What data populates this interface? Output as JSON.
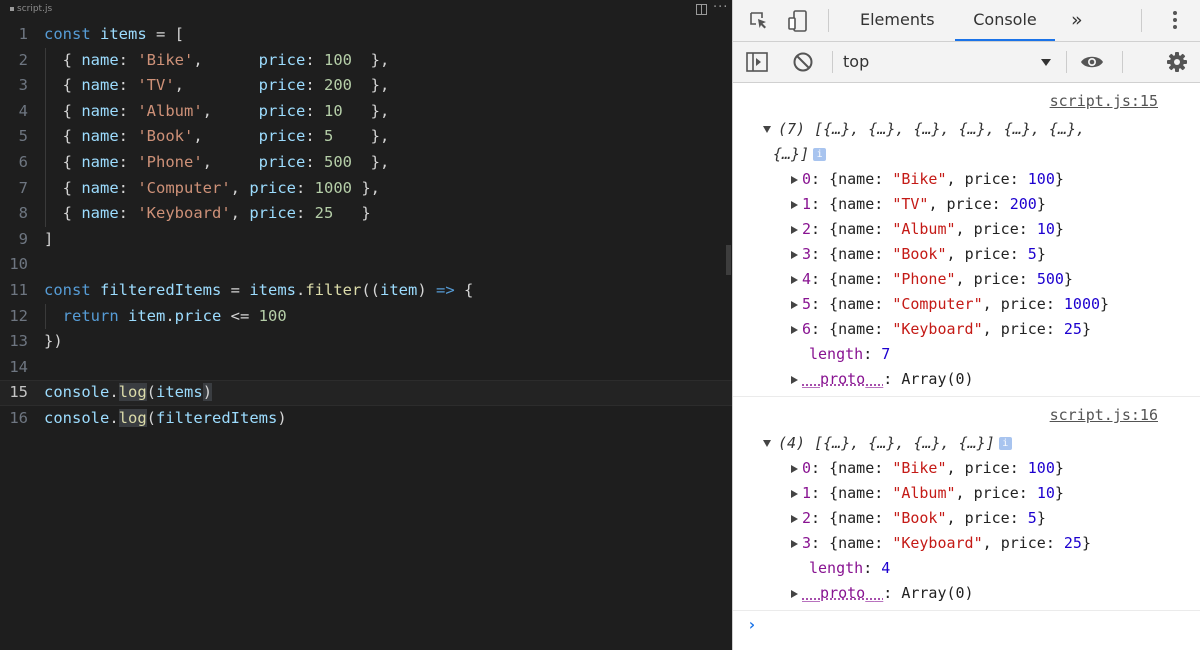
{
  "editor": {
    "tab_title": "script.js",
    "more_label": "···",
    "current_line": 15,
    "lines": [
      {
        "num": "1",
        "tokens": [
          {
            "t": "const ",
            "c": "kw"
          },
          {
            "t": "items",
            "c": "vr"
          },
          {
            "t": " = [",
            "c": "tx"
          }
        ]
      },
      {
        "num": "2",
        "tokens": [
          {
            "t": "  { ",
            "c": "tx"
          },
          {
            "t": "name",
            "c": "vr"
          },
          {
            "t": ": ",
            "c": "tx"
          },
          {
            "t": "'Bike'",
            "c": "st"
          },
          {
            "t": ",      ",
            "c": "tx"
          },
          {
            "t": "price",
            "c": "vr"
          },
          {
            "t": ": ",
            "c": "tx"
          },
          {
            "t": "100",
            "c": "nm"
          },
          {
            "t": "  },",
            "c": "tx"
          }
        ]
      },
      {
        "num": "3",
        "tokens": [
          {
            "t": "  { ",
            "c": "tx"
          },
          {
            "t": "name",
            "c": "vr"
          },
          {
            "t": ": ",
            "c": "tx"
          },
          {
            "t": "'TV'",
            "c": "st"
          },
          {
            "t": ",        ",
            "c": "tx"
          },
          {
            "t": "price",
            "c": "vr"
          },
          {
            "t": ": ",
            "c": "tx"
          },
          {
            "t": "200",
            "c": "nm"
          },
          {
            "t": "  },",
            "c": "tx"
          }
        ]
      },
      {
        "num": "4",
        "tokens": [
          {
            "t": "  { ",
            "c": "tx"
          },
          {
            "t": "name",
            "c": "vr"
          },
          {
            "t": ": ",
            "c": "tx"
          },
          {
            "t": "'Album'",
            "c": "st"
          },
          {
            "t": ",     ",
            "c": "tx"
          },
          {
            "t": "price",
            "c": "vr"
          },
          {
            "t": ": ",
            "c": "tx"
          },
          {
            "t": "10",
            "c": "nm"
          },
          {
            "t": "   },",
            "c": "tx"
          }
        ]
      },
      {
        "num": "5",
        "tokens": [
          {
            "t": "  { ",
            "c": "tx"
          },
          {
            "t": "name",
            "c": "vr"
          },
          {
            "t": ": ",
            "c": "tx"
          },
          {
            "t": "'Book'",
            "c": "st"
          },
          {
            "t": ",      ",
            "c": "tx"
          },
          {
            "t": "price",
            "c": "vr"
          },
          {
            "t": ": ",
            "c": "tx"
          },
          {
            "t": "5",
            "c": "nm"
          },
          {
            "t": "    },",
            "c": "tx"
          }
        ]
      },
      {
        "num": "6",
        "tokens": [
          {
            "t": "  { ",
            "c": "tx"
          },
          {
            "t": "name",
            "c": "vr"
          },
          {
            "t": ": ",
            "c": "tx"
          },
          {
            "t": "'Phone'",
            "c": "st"
          },
          {
            "t": ",     ",
            "c": "tx"
          },
          {
            "t": "price",
            "c": "vr"
          },
          {
            "t": ": ",
            "c": "tx"
          },
          {
            "t": "500",
            "c": "nm"
          },
          {
            "t": "  },",
            "c": "tx"
          }
        ]
      },
      {
        "num": "7",
        "tokens": [
          {
            "t": "  { ",
            "c": "tx"
          },
          {
            "t": "name",
            "c": "vr"
          },
          {
            "t": ": ",
            "c": "tx"
          },
          {
            "t": "'Computer'",
            "c": "st"
          },
          {
            "t": ", ",
            "c": "tx"
          },
          {
            "t": "price",
            "c": "vr"
          },
          {
            "t": ": ",
            "c": "tx"
          },
          {
            "t": "1000",
            "c": "nm"
          },
          {
            "t": " },",
            "c": "tx"
          }
        ]
      },
      {
        "num": "8",
        "tokens": [
          {
            "t": "  { ",
            "c": "tx"
          },
          {
            "t": "name",
            "c": "vr"
          },
          {
            "t": ": ",
            "c": "tx"
          },
          {
            "t": "'Keyboard'",
            "c": "st"
          },
          {
            "t": ", ",
            "c": "tx"
          },
          {
            "t": "price",
            "c": "vr"
          },
          {
            "t": ": ",
            "c": "tx"
          },
          {
            "t": "25",
            "c": "nm"
          },
          {
            "t": "   }",
            "c": "tx"
          }
        ]
      },
      {
        "num": "9",
        "tokens": [
          {
            "t": "]",
            "c": "tx"
          }
        ]
      },
      {
        "num": "10",
        "tokens": []
      },
      {
        "num": "11",
        "tokens": [
          {
            "t": "const ",
            "c": "kw"
          },
          {
            "t": "filteredItems",
            "c": "vr"
          },
          {
            "t": " = ",
            "c": "tx"
          },
          {
            "t": "items",
            "c": "vr"
          },
          {
            "t": ".",
            "c": "tx"
          },
          {
            "t": "filter",
            "c": "fn"
          },
          {
            "t": "((",
            "c": "tx"
          },
          {
            "t": "item",
            "c": "vr"
          },
          {
            "t": ") ",
            "c": "tx"
          },
          {
            "t": "=>",
            "c": "ar"
          },
          {
            "t": " {",
            "c": "tx"
          }
        ]
      },
      {
        "num": "12",
        "tokens": [
          {
            "t": "  ",
            "c": "tx"
          },
          {
            "t": "return ",
            "c": "kw"
          },
          {
            "t": "item",
            "c": "vr"
          },
          {
            "t": ".",
            "c": "tx"
          },
          {
            "t": "price",
            "c": "vr"
          },
          {
            "t": " <= ",
            "c": "tx"
          },
          {
            "t": "100",
            "c": "nm"
          }
        ]
      },
      {
        "num": "13",
        "tokens": [
          {
            "t": "})",
            "c": "tx"
          }
        ]
      },
      {
        "num": "14",
        "tokens": []
      },
      {
        "num": "15",
        "tokens": [
          {
            "t": "console",
            "c": "vr"
          },
          {
            "t": ".",
            "c": "tx"
          },
          {
            "t": "log",
            "c": "fn hl"
          },
          {
            "t": "(",
            "c": "tx"
          },
          {
            "t": "items",
            "c": "vr"
          },
          {
            "t": ")",
            "c": "tx hl"
          }
        ]
      },
      {
        "num": "16",
        "tokens": [
          {
            "t": "console",
            "c": "vr"
          },
          {
            "t": ".",
            "c": "tx"
          },
          {
            "t": "log",
            "c": "fn hl"
          },
          {
            "t": "(",
            "c": "tx"
          },
          {
            "t": "filteredItems",
            "c": "vr"
          },
          {
            "t": ")",
            "c": "tx"
          }
        ]
      }
    ]
  },
  "devtools": {
    "tabs": {
      "elements": "Elements",
      "console": "Console",
      "more": "»"
    },
    "context_select": "top",
    "messages": [
      {
        "source": "script.js:15",
        "summary_line1": "(7) [{…}, {…}, {…}, {…}, {…}, {…},",
        "summary_line2": "{…}]",
        "entries": [
          {
            "index": "0",
            "name": "\"Bike\"",
            "price": "100"
          },
          {
            "index": "1",
            "name": "\"TV\"",
            "price": "200"
          },
          {
            "index": "2",
            "name": "\"Album\"",
            "price": "10"
          },
          {
            "index": "3",
            "name": "\"Book\"",
            "price": "5"
          },
          {
            "index": "4",
            "name": "\"Phone\"",
            "price": "500"
          },
          {
            "index": "5",
            "name": "\"Computer\"",
            "price": "1000"
          },
          {
            "index": "6",
            "name": "\"Keyboard\"",
            "price": "25"
          }
        ],
        "length": "7",
        "proto": "Array(0)"
      },
      {
        "source": "script.js:16",
        "summary_line1": "(4) [{…}, {…}, {…}, {…}]",
        "summary_line2": "",
        "entries": [
          {
            "index": "0",
            "name": "\"Bike\"",
            "price": "100"
          },
          {
            "index": "1",
            "name": "\"Album\"",
            "price": "10"
          },
          {
            "index": "2",
            "name": "\"Book\"",
            "price": "5"
          },
          {
            "index": "3",
            "name": "\"Keyboard\"",
            "price": "25"
          }
        ],
        "length": "4",
        "proto": "Array(0)"
      }
    ],
    "labels": {
      "name_key": "name",
      "price_key": "price",
      "length_key": "length",
      "proto_key": "__proto__",
      "info_badge": "i",
      "prompt": "›"
    }
  }
}
